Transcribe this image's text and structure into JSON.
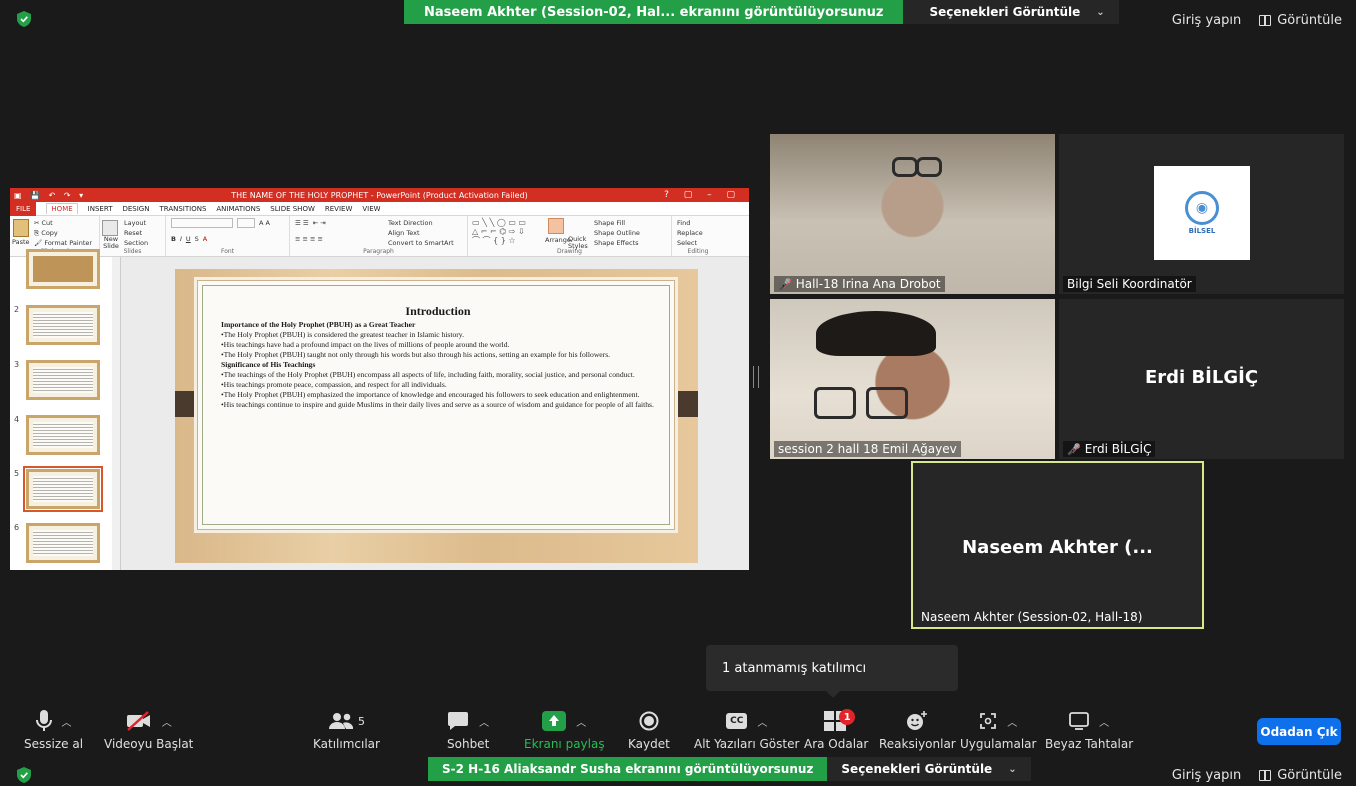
{
  "top_banner": {
    "sharing_text": "Naseem Akhter (Session-02, Hal... ekranını görüntülüyorsunuz",
    "options_label": "Seçenekleri Görüntüle"
  },
  "top_right": {
    "login": "Giriş yapın",
    "view": "Görüntüle"
  },
  "ppt": {
    "window_title": "THE NAME OF THE HOLY PROPHET -  PowerPoint (Product Activation Failed)",
    "tabs": [
      "FILE",
      "HOME",
      "INSERT",
      "DESIGN",
      "TRANSITIONS",
      "ANIMATIONS",
      "SLIDE SHOW",
      "REVIEW",
      "VIEW"
    ],
    "clipboard": {
      "cut": "Cut",
      "copy": "Copy",
      "format_painter": "Format Painter",
      "paste": "Paste",
      "label": "Clipboard"
    },
    "slides_group": {
      "layout": "Layout",
      "reset": "Reset",
      "section": "Section",
      "new_slide": "New Slide",
      "label": "Slides"
    },
    "font_group": {
      "label": "Font"
    },
    "paragraph_group": {
      "text_direction": "Text Direction",
      "align_text": "Align Text",
      "convert_smartart": "Convert to SmartArt",
      "label": "Paragraph"
    },
    "drawing_group": {
      "arrange": "Arrange",
      "quick_styles": "Quick Styles",
      "shape_fill": "Shape Fill",
      "shape_outline": "Shape Outline",
      "shape_effects": "Shape Effects",
      "label": "Drawing"
    },
    "editing_group": {
      "find": "Find",
      "replace": "Replace",
      "select": "Select",
      "label": "Editing"
    },
    "thumb_numbers": [
      "2",
      "3",
      "4",
      "5",
      "6"
    ],
    "slide": {
      "title": "Introduction",
      "heading1": "Importance of the Holy Prophet (PBUH) as a Great Teacher",
      "p1": "•The Holy Prophet (PBUH) is considered the greatest teacher in Islamic history.",
      "p2": "•His teachings have had a profound impact on the lives of millions of people around the world.",
      "p3": "•The Holy Prophet (PBUH) taught not only through his words but also through his actions, setting an example for his followers.",
      "heading2": "Significance of His Teachings",
      "p4": "•The teachings of the Holy Prophet (PBUH) encompass all aspects of life, including faith, morality, social justice, and personal conduct.",
      "p5": "•His teachings promote peace, compassion, and respect for all individuals.",
      "p6": "•The Holy Prophet (PBUH) emphasized the importance of knowledge and encouraged his followers to seek education and enlightenment.",
      "p7": "•His teachings continue to inspire and guide Muslims in their daily lives and serve as a source of wisdom and guidance for people of all faiths."
    }
  },
  "participants": {
    "irina": "Hall-18 Irina Ana Drobot",
    "bilgi": "Bilgi Seli Koordinatör",
    "bilgi_logo": "BİLSEL",
    "emil": "session 2 hall 18 Emil Ağayev",
    "erdi_center": "Erdi BİLGİÇ",
    "erdi_label": "Erdi BİLGİÇ",
    "naseem_center": "Naseem Akhter (...",
    "naseem_label": "Naseem Akhter (Session-02, Hall-18)"
  },
  "tooltip": "1 atanmamış katılımcı",
  "toolbar": {
    "mute": "Sessize al",
    "video": "Videoyu Başlat",
    "participants": "Katılımcılar",
    "participants_count": "5",
    "chat": "Sohbet",
    "share": "Ekranı paylaş",
    "record": "Kaydet",
    "captions": "Alt Yazıları Göster",
    "captions_icon": "CC",
    "breakout": "Ara Odalar",
    "breakout_badge": "1",
    "reactions": "Reaksiyonlar",
    "apps": "Uygulamalar",
    "whiteboard": "Beyaz Tahtalar",
    "leave": "Odadan Çık"
  },
  "bottom_banner": {
    "sharing_text": "S-2 H-16 Aliaksandr Susha ekranını görüntülüyorsunuz",
    "options_label": "Seçenekleri Görüntüle"
  },
  "bottom_right": {
    "login": "Giriş yapın",
    "view": "Görüntüle"
  },
  "colors": {
    "zoom_green": "#23a047",
    "leave_blue": "#0e71eb",
    "active_speaker": "#d6e98a",
    "ppt_red": "#d22e22"
  }
}
